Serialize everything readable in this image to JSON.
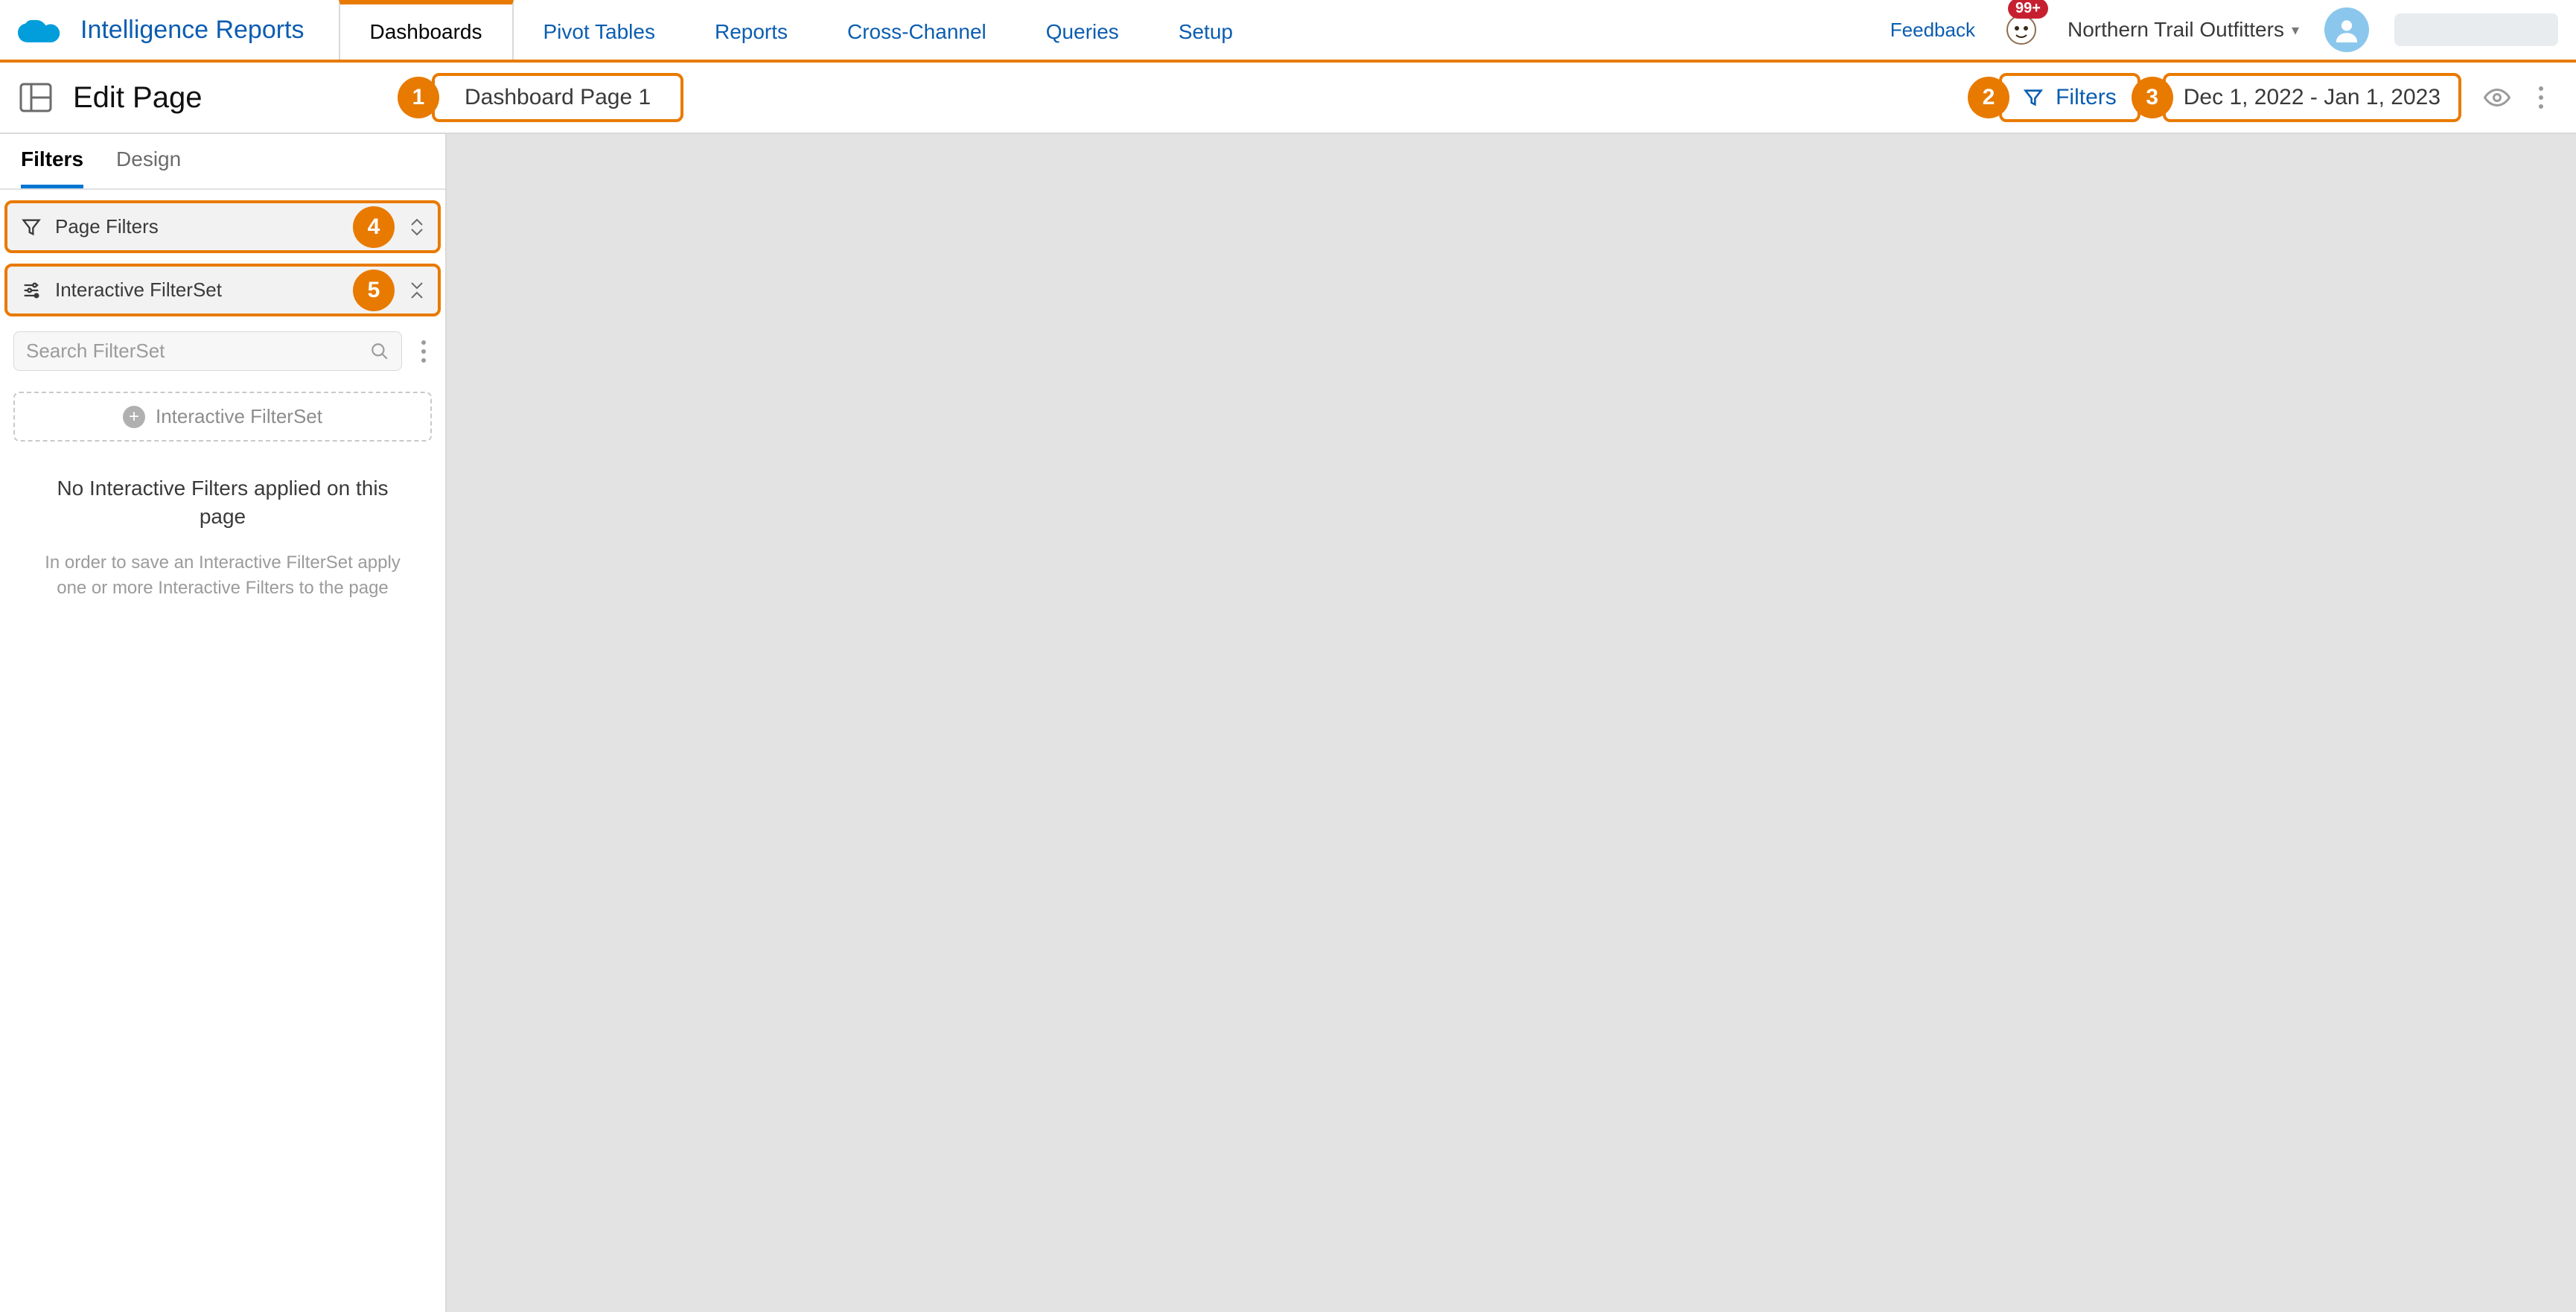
{
  "brand": {
    "title": "Intelligence Reports"
  },
  "nav": {
    "tabs": [
      "Dashboards",
      "Pivot Tables",
      "Reports",
      "Cross-Channel",
      "Queries",
      "Setup"
    ],
    "active_index": 0
  },
  "topright": {
    "feedback": "Feedback",
    "badge_count": "99+",
    "org_name": "Northern Trail Outfitters"
  },
  "editbar": {
    "title": "Edit Page",
    "page_name": "Dashboard Page 1",
    "filters_label": "Filters",
    "date_range": "Dec 1, 2022 - Jan 1, 2023"
  },
  "callouts": {
    "pagename": "1",
    "filters": "2",
    "date": "3",
    "page_filters": "4",
    "interactive_filterset": "5"
  },
  "sidebar": {
    "tabs": {
      "filters": "Filters",
      "design": "Design",
      "active": "filters"
    },
    "page_filters": {
      "label": "Page Filters"
    },
    "interactive_filterset": {
      "label": "Interactive FilterSet"
    },
    "search_placeholder": "Search FilterSet",
    "add_button": "Interactive FilterSet",
    "empty_title": "No Interactive Filters applied on this page",
    "empty_sub": "In order to save an Interactive FilterSet apply one or more Interactive Filters to the page"
  }
}
